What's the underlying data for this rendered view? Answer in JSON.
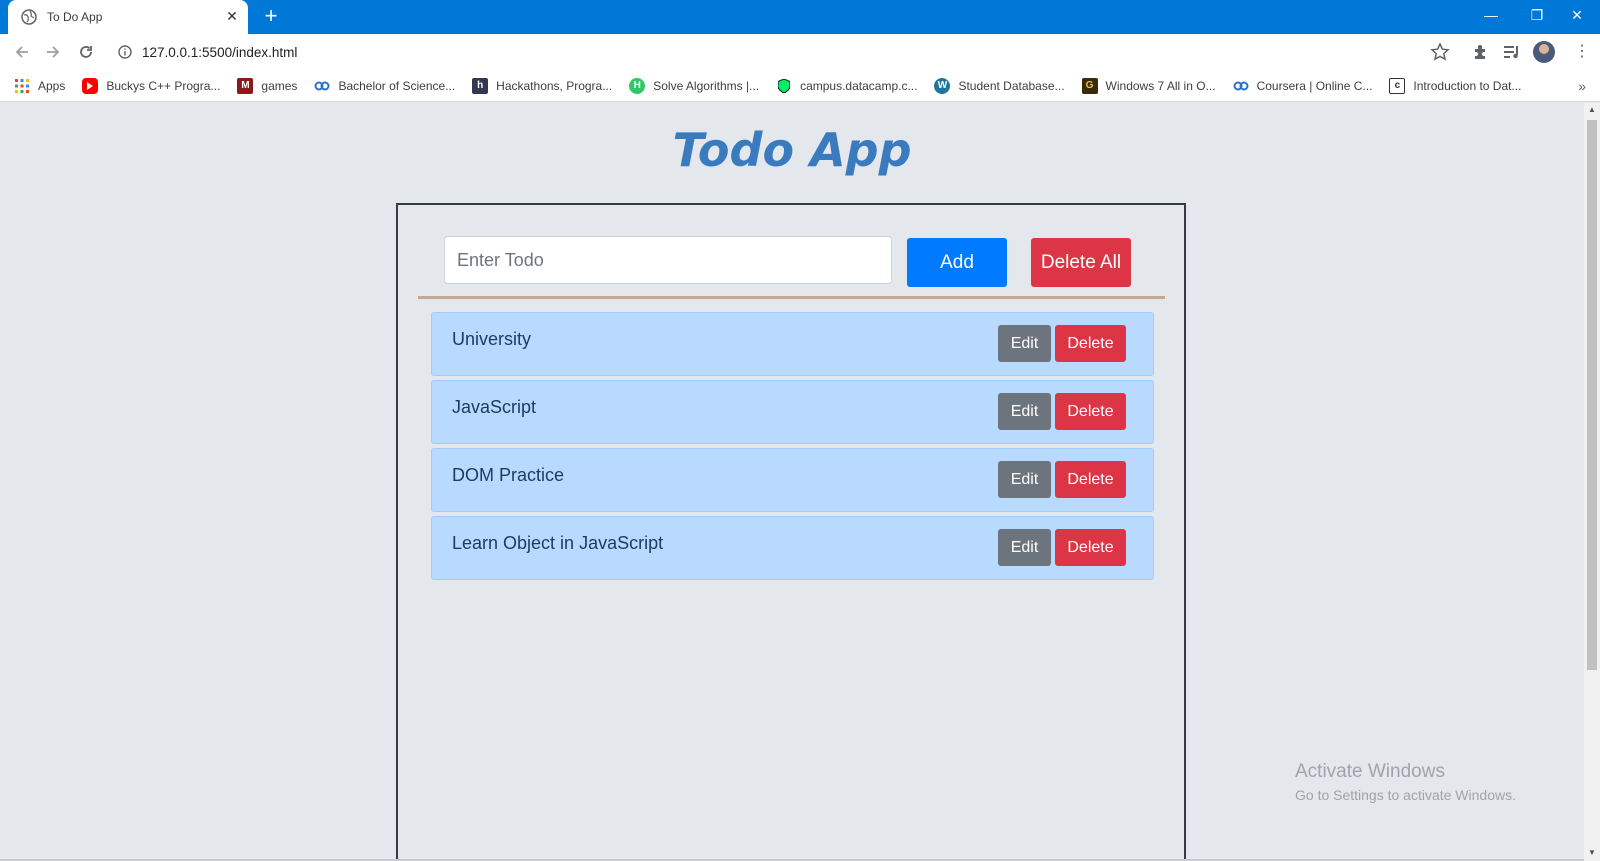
{
  "browser": {
    "tab_title": "To Do App",
    "tab_close": "✕",
    "new_tab": "+",
    "url": "127.0.0.1:5500/index.html",
    "window_controls": {
      "minimize": "—",
      "restore": "❐",
      "close": "✕"
    },
    "menu": "⋮"
  },
  "bookmarks": {
    "items": [
      {
        "label": "Apps",
        "icon": "apps-grid-icon"
      },
      {
        "label": "Buckys C++ Progra...",
        "icon": "youtube-icon"
      },
      {
        "label": "games",
        "icon": "games-icon"
      },
      {
        "label": "Bachelor of Science...",
        "icon": "coursera-icon"
      },
      {
        "label": "Hackathons, Progra...",
        "icon": "hackerearth-icon"
      },
      {
        "label": "Solve Algorithms |...",
        "icon": "hackerrank-icon"
      },
      {
        "label": "campus.datacamp.c...",
        "icon": "datacamp-icon"
      },
      {
        "label": "Student Database...",
        "icon": "wordpress-icon"
      },
      {
        "label": "Windows 7 All in O...",
        "icon": "g-icon"
      },
      {
        "label": "Coursera | Online C...",
        "icon": "coursera-icon"
      },
      {
        "label": "Introduction to Dat...",
        "icon": "doc-icon"
      }
    ],
    "more": "»"
  },
  "app": {
    "title": "Todo App",
    "input_placeholder": "Enter Todo",
    "input_value": "",
    "add_label": "Add",
    "delete_all_label": "Delete All",
    "todos": [
      {
        "text": "University",
        "edit_label": "Edit",
        "delete_label": "Delete"
      },
      {
        "text": "JavaScript",
        "edit_label": "Edit",
        "delete_label": "Delete"
      },
      {
        "text": "DOM Practice",
        "edit_label": "Edit",
        "delete_label": "Delete"
      },
      {
        "text": "Learn Object in JavaScript",
        "edit_label": "Edit",
        "delete_label": "Delete"
      }
    ]
  },
  "watermark": {
    "line1": "Activate Windows",
    "line2": "Go to Settings to activate Windows."
  },
  "colors": {
    "titlebar": "#0078d7",
    "title_text": "#3a7bc0",
    "primary": "#007bff",
    "danger": "#dc3545",
    "secondary": "#6c757d",
    "todo_item_bg": "#b8daff",
    "divider": "#c6a791"
  }
}
